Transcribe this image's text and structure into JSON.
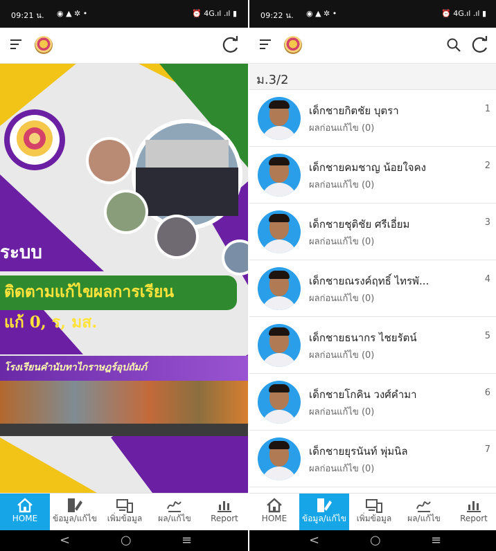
{
  "left": {
    "status": {
      "time": "09:21 น.",
      "icons_left": "◉ ▲ ✲ •",
      "icons_right": "⏰ 4G.ıl .ıl ▮"
    },
    "banner": {
      "system": "ระบบ",
      "follow": "ติดตามแก้ไขผลการเรียน",
      "fix": "แก้ 0, ร, มส.",
      "school": "โรงเรียนคำนับทาไกราษฎร์อุปถัมภ์"
    },
    "nav": [
      {
        "label": "HOME",
        "icon": "home-icon"
      },
      {
        "label": "ข้อมูล/แก้ไข",
        "icon": "edit-data-icon"
      },
      {
        "label": "เพิ่มข้อมูล",
        "icon": "devices-icon"
      },
      {
        "label": "ผล/แก้ไข",
        "icon": "signature-icon"
      },
      {
        "label": "Report",
        "icon": "report-chart-icon"
      }
    ],
    "active_nav": 0
  },
  "right": {
    "status": {
      "time": "09:22 น.",
      "icons_left": "◉ ▲ ✲ •",
      "icons_right": "⏰ 4G.ıl .ıl ▮"
    },
    "section": "ม.3/2",
    "students": [
      {
        "name": "เด็กชายกิตชัย บุตรา",
        "sub": "ผลก่อนแก้ไข (0)",
        "num": "1"
      },
      {
        "name": "เด็กชายคมชาญ น้อยใจคง",
        "sub": "ผลก่อนแก้ไข (0)",
        "num": "2"
      },
      {
        "name": "เด็กชายชุติชัย ศรีเอี่ยม",
        "sub": "ผลก่อนแก้ไข (0)",
        "num": "3"
      },
      {
        "name": "เด็กชายณรงค์ฤทธิ์ ไทรพั...",
        "sub": "ผลก่อนแก้ไข (0)",
        "num": "4"
      },
      {
        "name": "เด็กชายธนากร ไชยรัตน์",
        "sub": "ผลก่อนแก้ไข (0)",
        "num": "5"
      },
      {
        "name": "เด็กชายโกคิน วงศ์คำมา",
        "sub": "ผลก่อนแก้ไข (0)",
        "num": "6"
      },
      {
        "name": "เด็กชายยุรนันท์ พุ่มนิล",
        "sub": "ผลก่อนแก้ไข (0)",
        "num": "7"
      }
    ],
    "nav": [
      {
        "label": "HOME",
        "icon": "home-icon"
      },
      {
        "label": "ข้อมูล/แก้ไข",
        "icon": "edit-data-icon"
      },
      {
        "label": "เพิ่มข้อมูล",
        "icon": "devices-icon"
      },
      {
        "label": "ผล/แก้ไข",
        "icon": "signature-icon"
      },
      {
        "label": "Report",
        "icon": "report-chart-icon"
      }
    ],
    "active_nav": 1
  },
  "sysnav": {
    "back": "<",
    "home": "○",
    "recents": "≡"
  },
  "colors": {
    "accent": "#16a6e8",
    "banner_purple": "#6b1fa3",
    "banner_green": "#2f8a2f",
    "banner_yellow": "#f2c418"
  }
}
